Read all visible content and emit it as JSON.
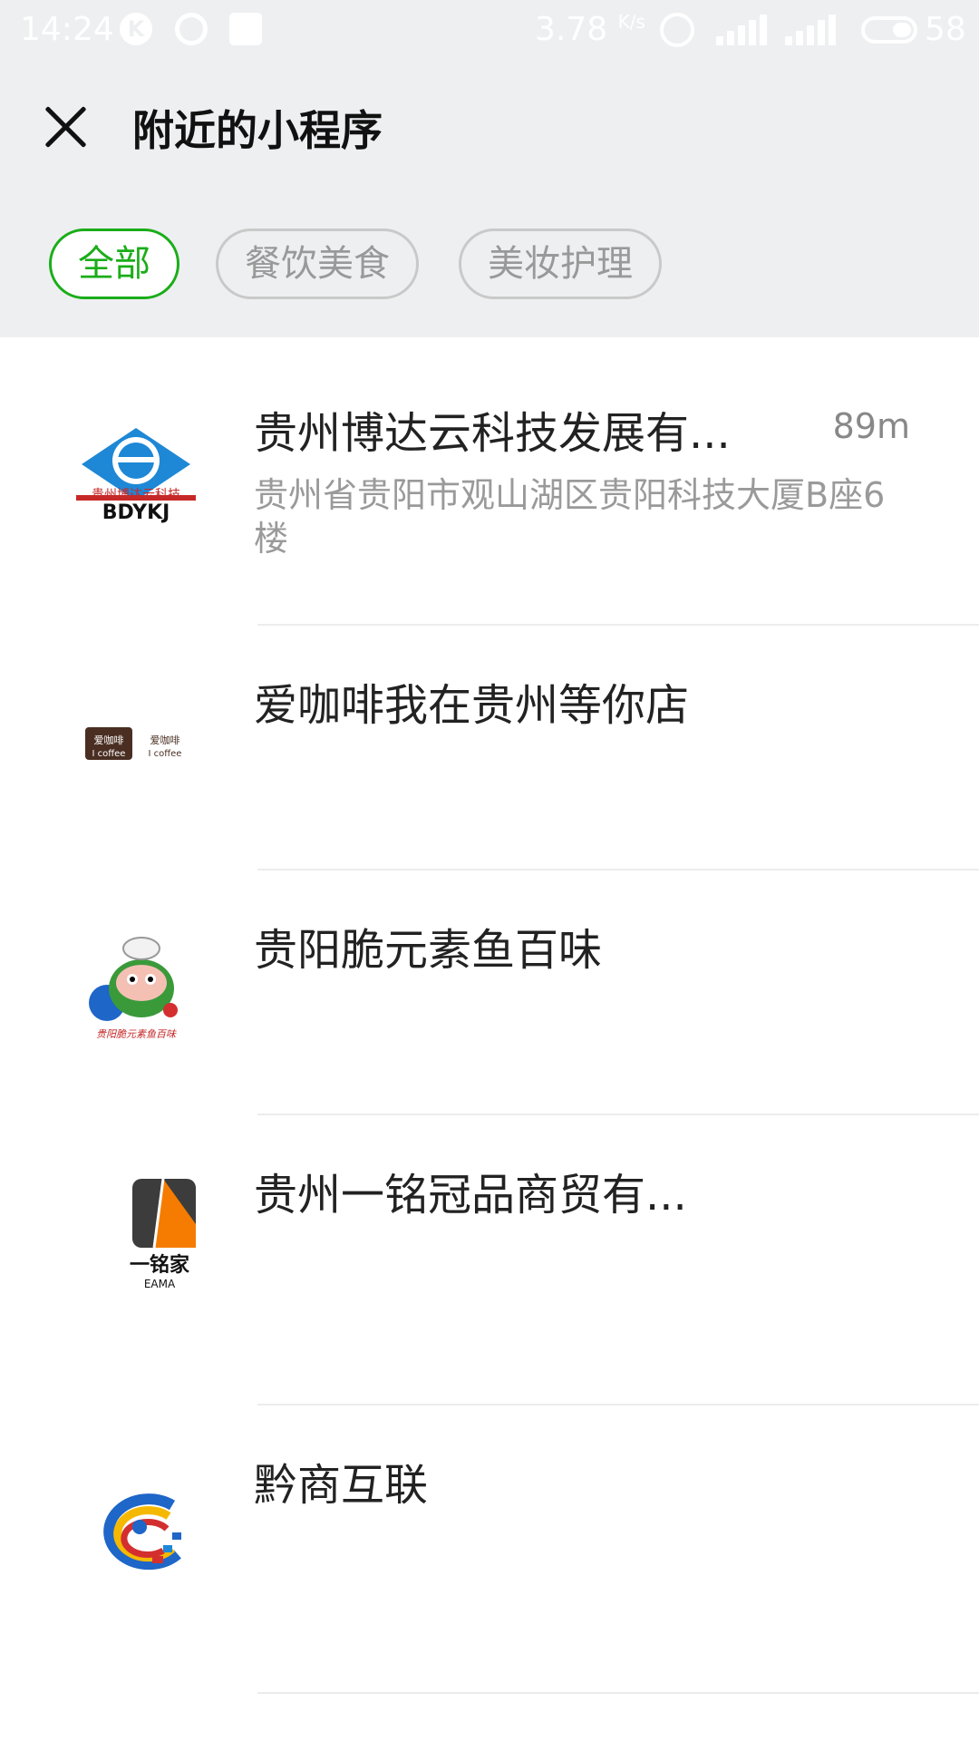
{
  "status_bar": {
    "time": "14:24",
    "notifications": [
      "k-badge-icon",
      "moon-icon",
      "message-box-icon"
    ],
    "network_speed": "3.78",
    "speed_unit": "K/s",
    "signal_label": "4G",
    "battery_level": "58"
  },
  "header": {
    "close_icon": "close-icon",
    "title": "附近的小程序"
  },
  "tabs": [
    {
      "label": "全部",
      "active": true
    },
    {
      "label": "餐饮美食",
      "active": false
    },
    {
      "label": "美妆护理",
      "active": false
    }
  ],
  "list": {
    "items": [
      {
        "name": "贵州博达云科技发展有...",
        "distance": "89m",
        "address": "贵州省贵阳市观山湖区贵阳科技大厦B座6楼",
        "logo_text": "贵州博达云科技",
        "logo_subtext": "BDYKJ"
      },
      {
        "name": "爱咖啡我在贵州等你店",
        "logo_text": "爱咖啡",
        "logo_subtext": "I coffee"
      },
      {
        "name": "贵阳脆元素鱼百味",
        "logo_text": "贵阳脆元素鱼百味"
      },
      {
        "name": "贵州一铭冠品商贸有...",
        "logo_text": "一铭家",
        "logo_subtext": "EAMA"
      },
      {
        "name": "黔商互联"
      }
    ]
  },
  "colors": {
    "accent": "#1aad19",
    "header_bg": "#eeeff1",
    "muted_text": "#9a9a9a"
  }
}
